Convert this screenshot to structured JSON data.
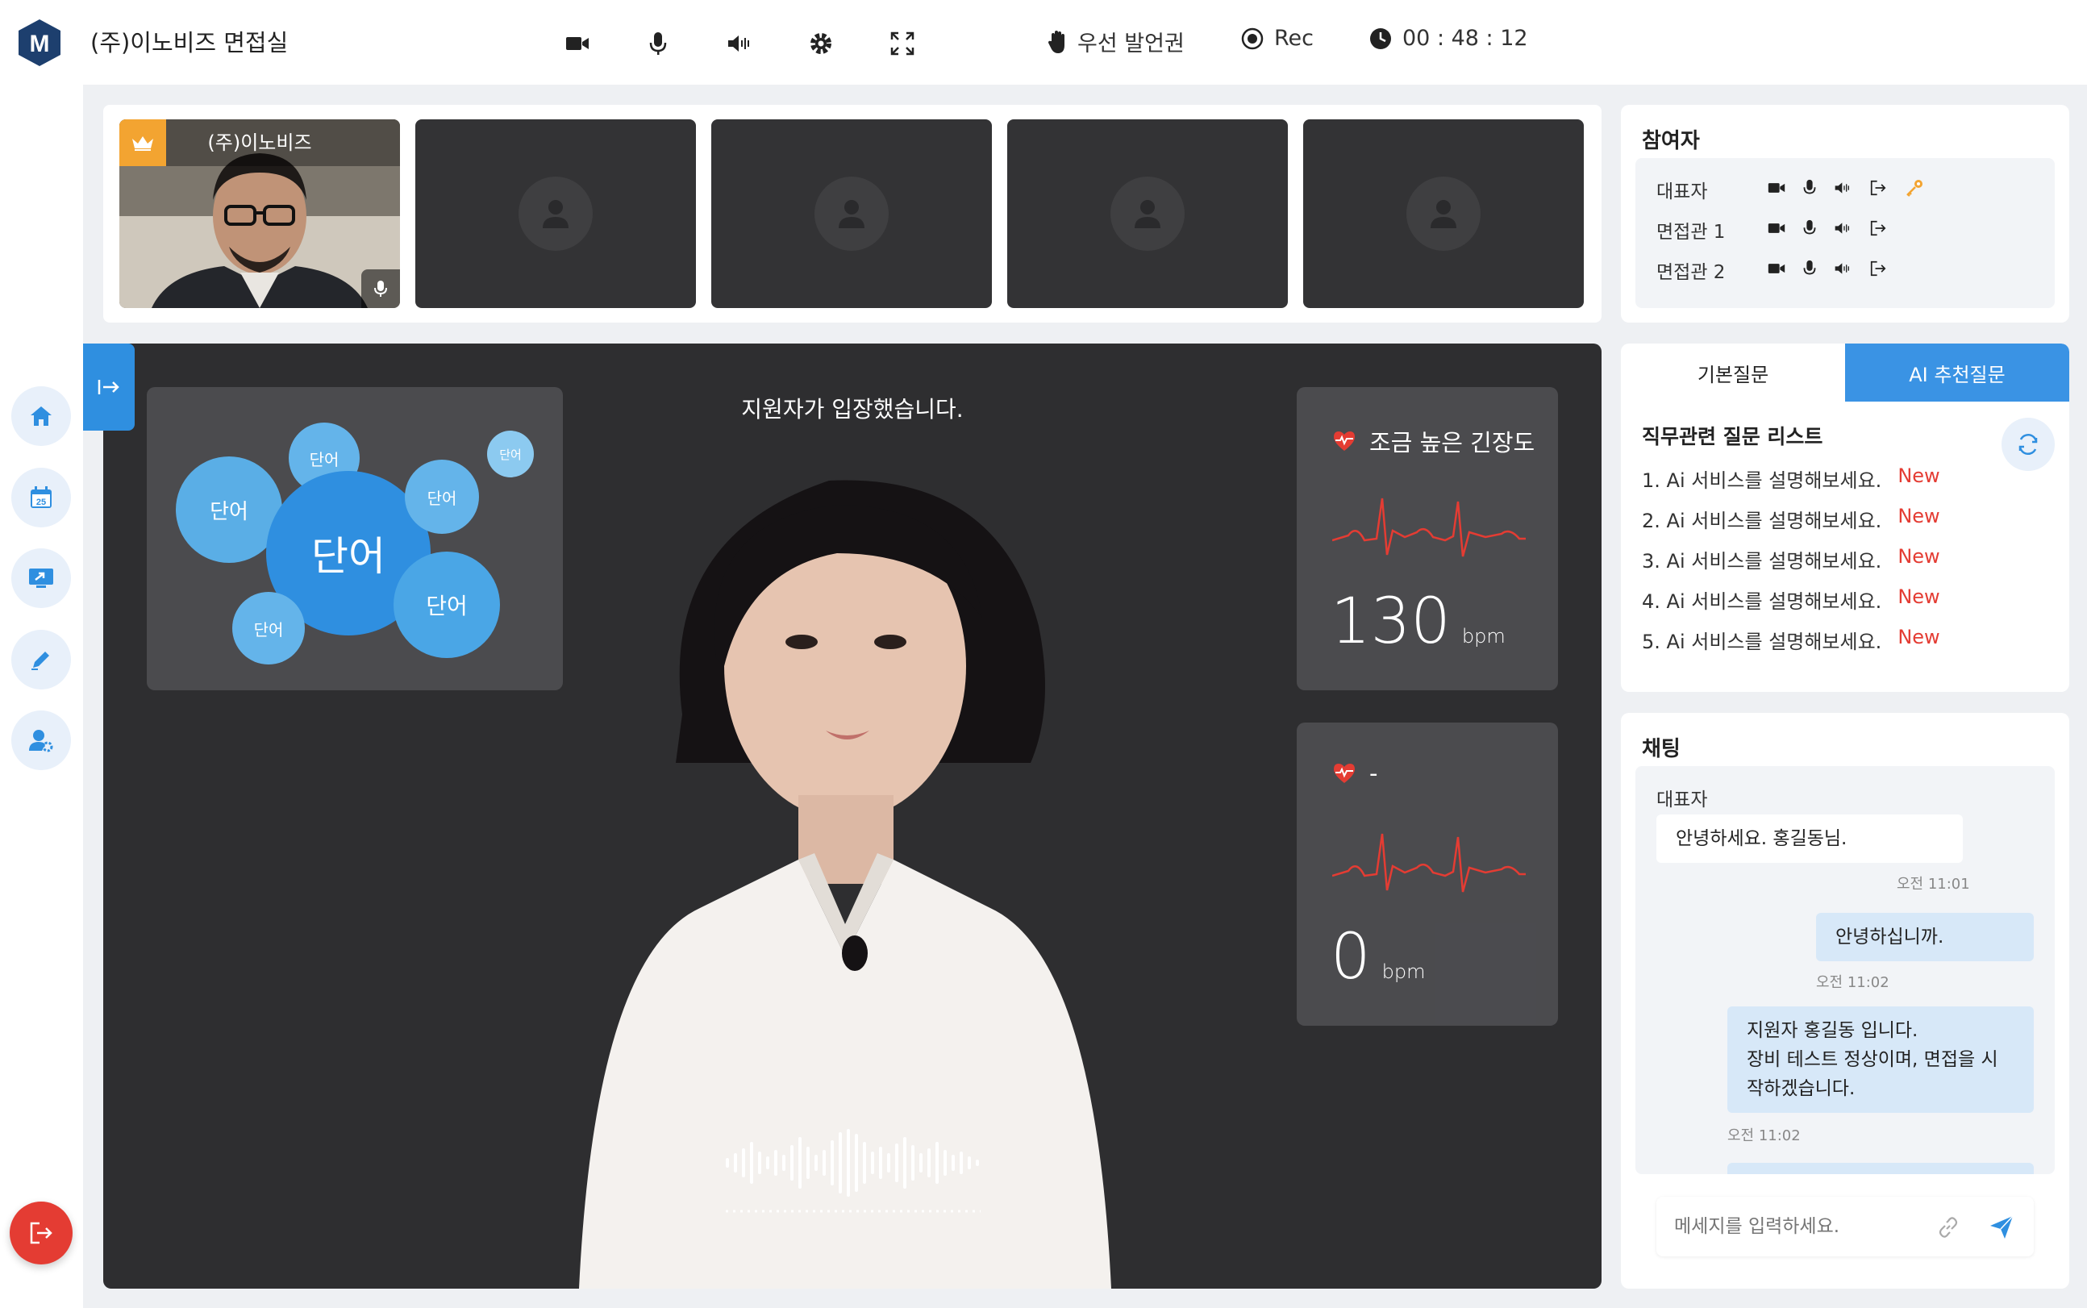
{
  "app": {
    "logo_letter": "M",
    "room_title": "(주)이노비즈 면접실"
  },
  "toolbar": {
    "icons": [
      "video-camera-icon",
      "microphone-icon",
      "speaker-icon",
      "settings-gear-icon",
      "fullscreen-icon"
    ],
    "priority_label": "우선 발언권",
    "rec_label": "Rec",
    "timer": "00 : 48 : 12"
  },
  "nav": {
    "items": [
      "home-icon",
      "calendar-icon",
      "screen-share-icon",
      "edit-pencil-icon",
      "user-settings-icon"
    ],
    "calendar_day": "25",
    "exit_icon": "exit-icon"
  },
  "thumbnails": {
    "host_name": "(주)이노비즈"
  },
  "stage": {
    "notice": "지원자가 입장했습니다.",
    "word_cloud": {
      "words": [
        "단어",
        "단어",
        "단어",
        "단어",
        "단어",
        "단어",
        "단어"
      ]
    },
    "vitals": [
      {
        "label": "조금 높은 긴장도",
        "value": "130",
        "unit": "bpm"
      },
      {
        "label": "-",
        "value": "0",
        "unit": "bpm"
      }
    ]
  },
  "participants": {
    "title": "참여자",
    "rows": [
      {
        "name": "대표자",
        "has_key": true
      },
      {
        "name": "면접관 1",
        "has_key": false
      },
      {
        "name": "면접관 2",
        "has_key": false
      }
    ]
  },
  "questions": {
    "tabs": [
      "기본질문",
      "AI 추천질문"
    ],
    "active_tab": 1,
    "list_title": "직무관련 질문 리스트",
    "items": [
      {
        "text": "1. Ai 서비스를 설명해보세요.",
        "badge": "New"
      },
      {
        "text": "2. Ai 서비스를 설명해보세요.",
        "badge": "New"
      },
      {
        "text": "3. Ai 서비스를 설명해보세요.",
        "badge": "New"
      },
      {
        "text": "4. Ai 서비스를 설명해보세요.",
        "badge": "New"
      },
      {
        "text": "5. Ai 서비스를 설명해보세요.",
        "badge": "New"
      }
    ]
  },
  "chat": {
    "title": "채팅",
    "sender": "대표자",
    "messages": [
      {
        "text": "안녕하세요. 홍길동님.",
        "time": "오전 11:01",
        "side": "left"
      },
      {
        "text": "안녕하십니까.",
        "time": "오전 11:02",
        "side": "right"
      },
      {
        "text": "지원자 홍길동 입니다.\n장비 테스트 정상이며, 면접을 시\n작하겠습니다.",
        "time": "오전 11:02",
        "side": "right"
      }
    ],
    "input_placeholder": "메세지를 입력하세요."
  },
  "colors": {
    "accent": "#3a93e4",
    "danger": "#e43c33",
    "crown": "#f3a431",
    "bubble_dark": "#2f8fe0",
    "bubble_light": "#64b4ea"
  }
}
